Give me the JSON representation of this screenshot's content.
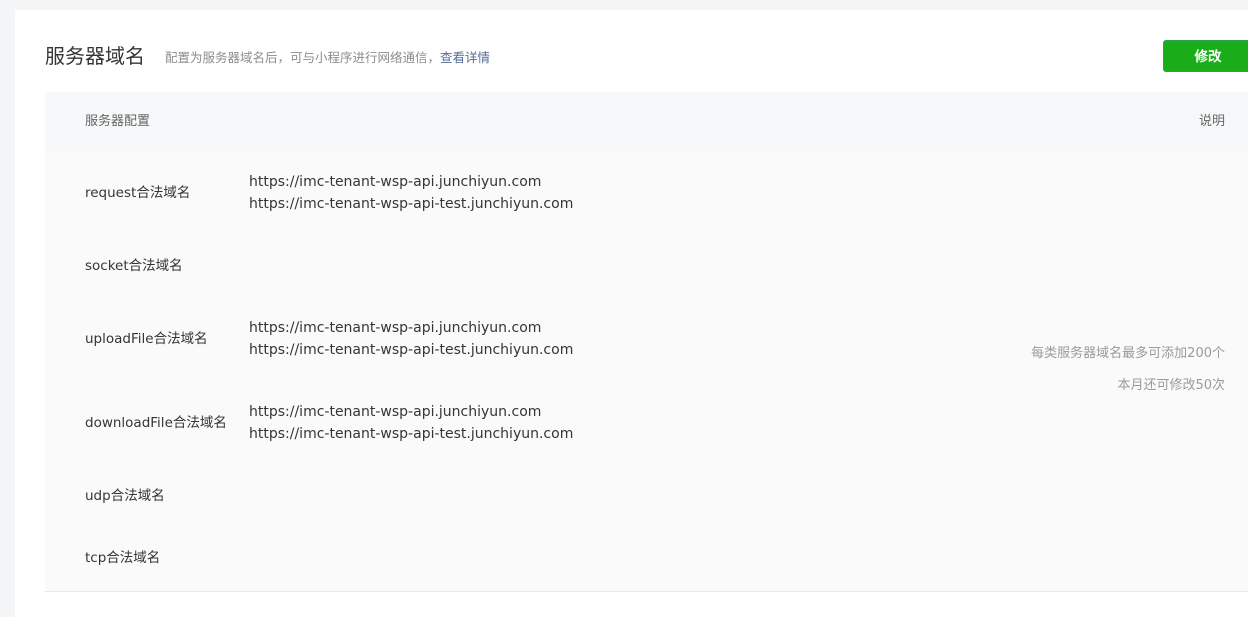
{
  "header": {
    "title": "服务器域名",
    "description": "配置为服务器域名后，可与小程序进行网络通信，",
    "detail_link": "查看详情",
    "edit_button": "修改"
  },
  "table": {
    "col_config": "服务器配置",
    "col_note": "说明",
    "rows": [
      {
        "label": "request合法域名",
        "domains": [
          "https://imc-tenant-wsp-api.junchiyun.com",
          "https://imc-tenant-wsp-api-test.junchiyun.com"
        ]
      },
      {
        "label": "socket合法域名",
        "domains": []
      },
      {
        "label": "uploadFile合法域名",
        "domains": [
          "https://imc-tenant-wsp-api.junchiyun.com",
          "https://imc-tenant-wsp-api-test.junchiyun.com"
        ]
      },
      {
        "label": "downloadFile合法域名",
        "domains": [
          "https://imc-tenant-wsp-api.junchiyun.com",
          "https://imc-tenant-wsp-api-test.junchiyun.com"
        ]
      },
      {
        "label": "udp合法域名",
        "domains": []
      },
      {
        "label": "tcp合法域名",
        "domains": []
      }
    ],
    "notes": [
      "每类服务器域名最多可添加200个",
      "本月还可修改50次"
    ]
  }
}
